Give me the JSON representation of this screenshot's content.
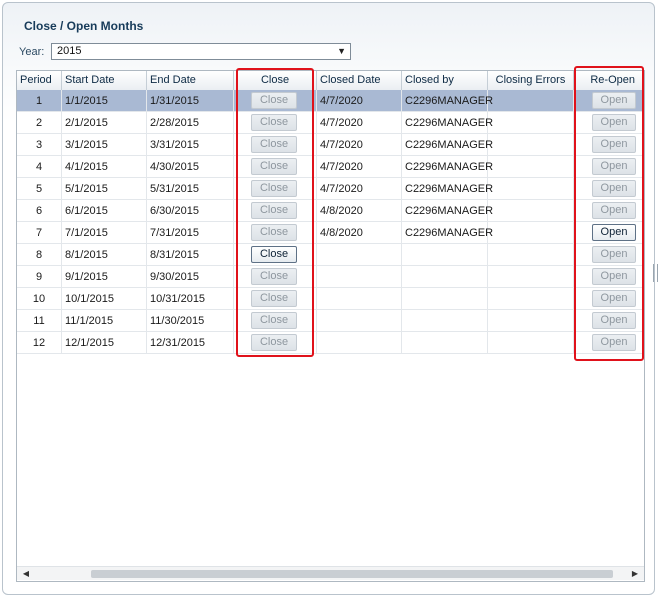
{
  "dialog": {
    "title": "Close / Open Months",
    "year_label": "Year:",
    "year_value": "2015"
  },
  "grid": {
    "columns": {
      "period": "Period",
      "start_date": "Start Date",
      "end_date": "End Date",
      "close": "Close",
      "closed_date": "Closed Date",
      "closed_by": "Closed by",
      "closing_errors": "Closing Errors",
      "reopen": "Re-Open"
    },
    "rows": [
      {
        "period": "1",
        "start": "1/1/2015",
        "end": "1/31/2015",
        "close_label": "Close",
        "close_enabled": false,
        "closed_date": "4/7/2020",
        "closed_by": "C2296MANAGER",
        "errors": "",
        "open_label": "Open",
        "open_enabled": false,
        "selected": true
      },
      {
        "period": "2",
        "start": "2/1/2015",
        "end": "2/28/2015",
        "close_label": "Close",
        "close_enabled": false,
        "closed_date": "4/7/2020",
        "closed_by": "C2296MANAGER",
        "errors": "",
        "open_label": "Open",
        "open_enabled": false,
        "selected": false
      },
      {
        "period": "3",
        "start": "3/1/2015",
        "end": "3/31/2015",
        "close_label": "Close",
        "close_enabled": false,
        "closed_date": "4/7/2020",
        "closed_by": "C2296MANAGER",
        "errors": "",
        "open_label": "Open",
        "open_enabled": false,
        "selected": false
      },
      {
        "period": "4",
        "start": "4/1/2015",
        "end": "4/30/2015",
        "close_label": "Close",
        "close_enabled": false,
        "closed_date": "4/7/2020",
        "closed_by": "C2296MANAGER",
        "errors": "",
        "open_label": "Open",
        "open_enabled": false,
        "selected": false
      },
      {
        "period": "5",
        "start": "5/1/2015",
        "end": "5/31/2015",
        "close_label": "Close",
        "close_enabled": false,
        "closed_date": "4/7/2020",
        "closed_by": "C2296MANAGER",
        "errors": "",
        "open_label": "Open",
        "open_enabled": false,
        "selected": false
      },
      {
        "period": "6",
        "start": "6/1/2015",
        "end": "6/30/2015",
        "close_label": "Close",
        "close_enabled": false,
        "closed_date": "4/8/2020",
        "closed_by": "C2296MANAGER",
        "errors": "",
        "open_label": "Open",
        "open_enabled": false,
        "selected": false
      },
      {
        "period": "7",
        "start": "7/1/2015",
        "end": "7/31/2015",
        "close_label": "Close",
        "close_enabled": false,
        "closed_date": "4/8/2020",
        "closed_by": "C2296MANAGER",
        "errors": "",
        "open_label": "Open",
        "open_enabled": true,
        "selected": false
      },
      {
        "period": "8",
        "start": "8/1/2015",
        "end": "8/31/2015",
        "close_label": "Close",
        "close_enabled": true,
        "closed_date": "",
        "closed_by": "",
        "errors": "",
        "open_label": "Open",
        "open_enabled": false,
        "selected": false
      },
      {
        "period": "9",
        "start": "9/1/2015",
        "end": "9/30/2015",
        "close_label": "Close",
        "close_enabled": false,
        "closed_date": "",
        "closed_by": "",
        "errors": "",
        "open_label": "Open",
        "open_enabled": false,
        "selected": false
      },
      {
        "period": "10",
        "start": "10/1/2015",
        "end": "10/31/2015",
        "close_label": "Close",
        "close_enabled": false,
        "closed_date": "",
        "closed_by": "",
        "errors": "",
        "open_label": "Open",
        "open_enabled": false,
        "selected": false
      },
      {
        "period": "11",
        "start": "11/1/2015",
        "end": "11/30/2015",
        "close_label": "Close",
        "close_enabled": false,
        "closed_date": "",
        "closed_by": "",
        "errors": "",
        "open_label": "Open",
        "open_enabled": false,
        "selected": false
      },
      {
        "period": "12",
        "start": "12/1/2015",
        "end": "12/31/2015",
        "close_label": "Close",
        "close_enabled": false,
        "closed_date": "",
        "closed_by": "",
        "errors": "",
        "open_label": "Open",
        "open_enabled": false,
        "selected": false
      }
    ]
  },
  "scrollbar": {
    "left_icon": "triangle-left-icon",
    "right_icon": "triangle-right-icon"
  },
  "colors": {
    "selected_row": "#a9b9d3",
    "highlight_box": "#e0121b",
    "title": "#173b5a"
  }
}
